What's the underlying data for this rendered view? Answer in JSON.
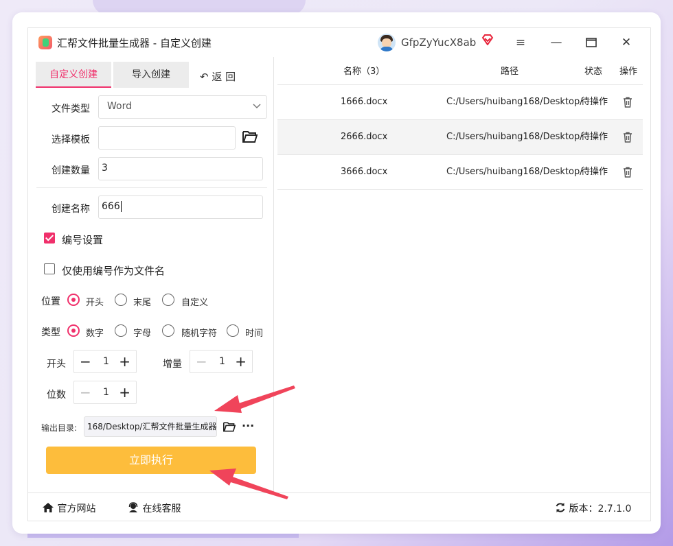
{
  "window": {
    "title": "汇帮文件批量生成器 - 自定义创建",
    "username": "GfpZyYucX8ab",
    "controls": {
      "menu": "≡",
      "minimize": "—",
      "maximize": "☐",
      "close": "✕"
    }
  },
  "tabs": [
    {
      "label": "自定义创建",
      "active": true
    },
    {
      "label": "导入创建",
      "active": false
    }
  ],
  "back_label": "返 回",
  "form": {
    "file_type_label": "文件类型",
    "file_type_value": "Word",
    "template_label": "选择模板",
    "template_value": "",
    "count_label": "创建数量",
    "count_value": "3",
    "name_label": "创建名称",
    "name_value": "666",
    "numbering_label": "编号设置",
    "numbering_checked": true,
    "only_number_label": "仅使用编号作为文件名",
    "only_number_checked": false,
    "position_label": "位置",
    "position_options": [
      "开头",
      "末尾",
      "自定义"
    ],
    "position_selected": "开头",
    "type_label": "类型",
    "type_options": [
      "数字",
      "字母",
      "随机字符",
      "时间"
    ],
    "type_selected": "数字",
    "start_label": "开头",
    "start_value": "1",
    "increment_label": "增量",
    "increment_value": "1",
    "digits_label": "位数",
    "digits_value": "1",
    "output_label": "输出目录:",
    "output_value": "168/Desktop/汇帮文件批量生成器",
    "execute_label": "立即执行"
  },
  "table": {
    "headers": {
      "name": "名称（3）",
      "path": "路径",
      "status": "状态",
      "action": "操作"
    },
    "rows": [
      {
        "name": "1666.docx",
        "path": "C:/Users/huibang168/Desktop/",
        "status": "待操作"
      },
      {
        "name": "2666.docx",
        "path": "C:/Users/huibang168/Desktop/",
        "status": "待操作"
      },
      {
        "name": "3666.docx",
        "path": "C:/Users/huibang168/Desktop/",
        "status": "待操作"
      }
    ]
  },
  "footer": {
    "website": "官方网站",
    "support": "在线客服",
    "version": "版本：2.7.1.0"
  },
  "colors": {
    "accent": "#f0306b",
    "execute": "#fdbd3c",
    "annotation_arrow": "#f0445a"
  }
}
